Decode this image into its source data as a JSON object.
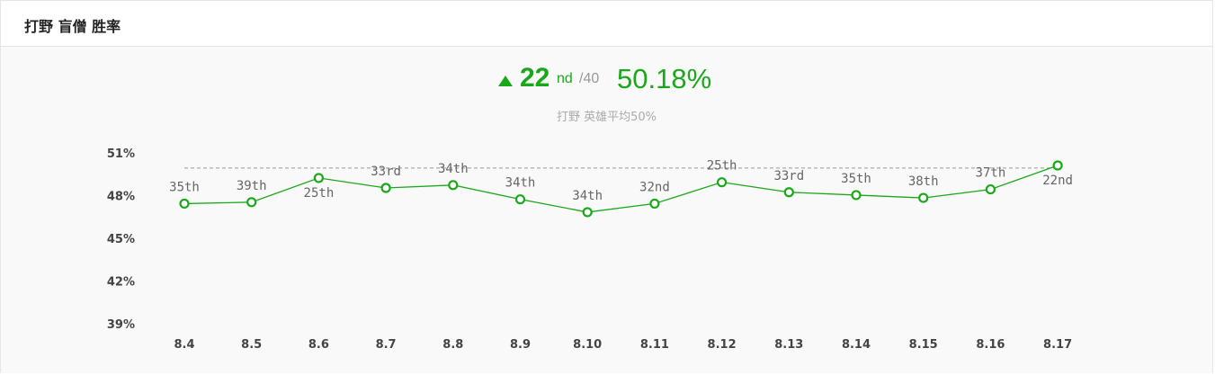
{
  "header": {
    "title": "打野 盲僧 胜率"
  },
  "summary": {
    "rank": "22",
    "rank_suffix": "nd",
    "rank_total": "/40",
    "win_rate": "50.18%",
    "subtitle": "打野 英雄平均50%"
  },
  "colors": {
    "accent": "#1aa81a",
    "reference_line": "#999999"
  },
  "chart_data": {
    "type": "line",
    "categories": [
      "8.4",
      "8.5",
      "8.6",
      "8.7",
      "8.8",
      "8.9",
      "8.10",
      "8.11",
      "8.12",
      "8.13",
      "8.14",
      "8.15",
      "8.16",
      "8.17"
    ],
    "series": [
      {
        "values": [
          47.5,
          47.6,
          49.3,
          48.6,
          48.8,
          47.8,
          46.9,
          47.5,
          49.0,
          48.3,
          48.1,
          47.9,
          48.5,
          50.18
        ],
        "labels": [
          "35th",
          "39th",
          "25th",
          "33rd",
          "34th",
          "34th",
          "34th",
          "32nd",
          "25th",
          "33rd",
          "35th",
          "38th",
          "37th",
          "22nd"
        ],
        "label_position": [
          "above",
          "above",
          "below",
          "above",
          "above",
          "above",
          "above",
          "above",
          "above",
          "above",
          "above",
          "above",
          "above",
          "below"
        ]
      }
    ],
    "reference_line": 50,
    "yticks": [
      51,
      48,
      45,
      42,
      39
    ],
    "ytick_labels": [
      "51%",
      "48%",
      "45%",
      "42%",
      "39%"
    ],
    "ylim": [
      39,
      51
    ],
    "grid": false
  }
}
